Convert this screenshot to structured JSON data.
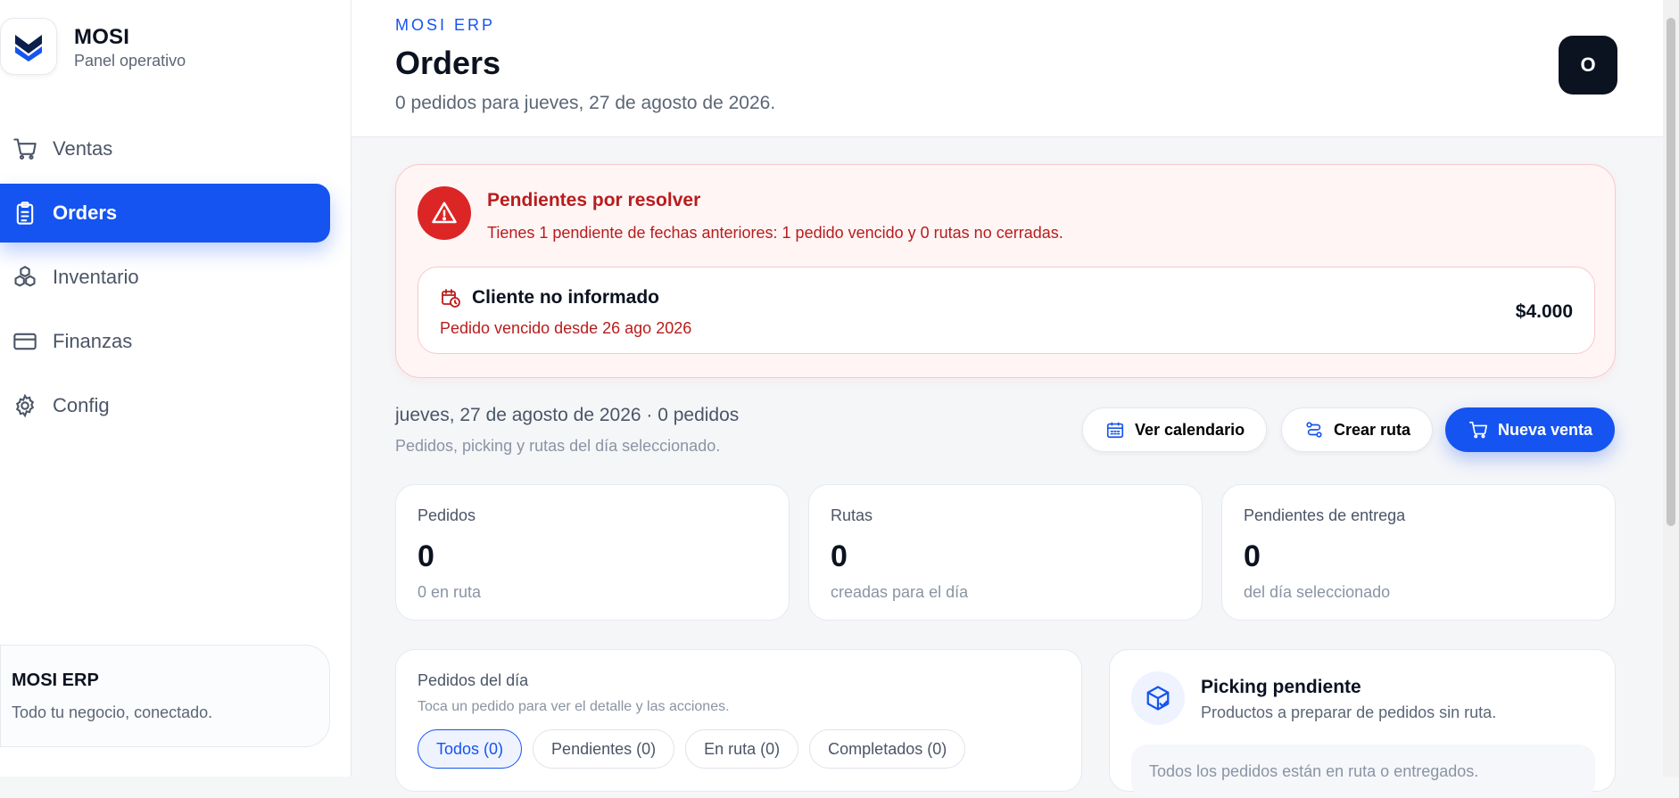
{
  "sidebar": {
    "brand_name": "MOSI",
    "brand_sub": "Panel operativo",
    "items": [
      {
        "label": "Ventas"
      },
      {
        "label": "Orders"
      },
      {
        "label": "Inventario"
      },
      {
        "label": "Finanzas"
      },
      {
        "label": "Config"
      }
    ],
    "footer_title": "MOSI ERP",
    "footer_sub": "Todo tu negocio, conectado."
  },
  "header": {
    "eyebrow": "MOSI ERP",
    "title": "Orders",
    "subtitle": "0 pedidos para jueves, 27 de agosto de 2026.",
    "avatar_initial": "O"
  },
  "alert": {
    "title": "Pendientes por resolver",
    "text": "Tienes 1 pendiente de fechas anteriores: 1 pedido vencido y 0 rutas no cerradas.",
    "item": {
      "title": "Cliente no informado",
      "subtitle": "Pedido vencido desde 26 ago 2026",
      "amount": "$4.000"
    }
  },
  "day": {
    "title": "jueves, 27 de agosto de 2026 · 0 pedidos",
    "subtitle": "Pedidos, picking y rutas del día seleccionado."
  },
  "actions": {
    "calendar": "Ver calendario",
    "route": "Crear ruta",
    "new_sale": "Nueva venta"
  },
  "stats": [
    {
      "label": "Pedidos",
      "value": "0",
      "note": "0 en ruta"
    },
    {
      "label": "Rutas",
      "value": "0",
      "note": "creadas para el día"
    },
    {
      "label": "Pendientes de entrega",
      "value": "0",
      "note": "del día seleccionado"
    }
  ],
  "orders_panel": {
    "title": "Pedidos del día",
    "subtitle": "Toca un pedido para ver el detalle y las acciones.",
    "filters": [
      "Todos (0)",
      "Pendientes (0)",
      "En ruta (0)",
      "Completados (0)"
    ]
  },
  "picking_panel": {
    "title": "Picking pendiente",
    "subtitle": "Productos a preparar de pedidos sin ruta.",
    "empty_text": "Todos los pedidos están en ruta o entregados."
  },
  "colors": {
    "accent": "#1554f0",
    "danger": "#dc2626",
    "dark": "#0b1220"
  },
  "icons": [
    "mosi-logo",
    "cart-icon",
    "clipboard-icon",
    "boxes-icon",
    "card-icon",
    "gear-icon",
    "warning-icon",
    "calendar-clock-icon",
    "calendar-icon",
    "route-icon",
    "package-check-icon"
  ]
}
